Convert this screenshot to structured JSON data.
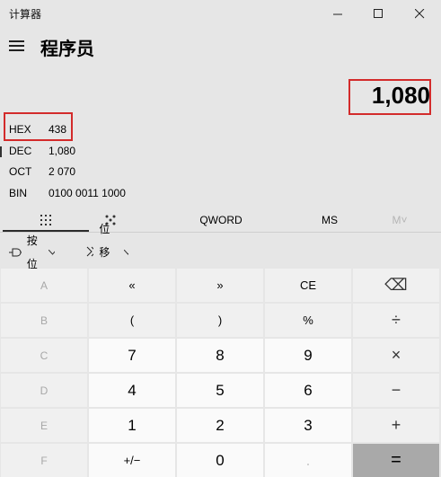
{
  "window": {
    "title": "计算器",
    "controls": [
      "minimize",
      "maximize",
      "close"
    ]
  },
  "header": {
    "mode_title": "程序员"
  },
  "display": {
    "value": "1,080"
  },
  "radix": [
    {
      "label": "HEX",
      "value": "438"
    },
    {
      "label": "DEC",
      "value": "1,080"
    },
    {
      "label": "OCT",
      "value": "2 070"
    },
    {
      "label": "BIN",
      "value": "0100 0011 1000"
    }
  ],
  "keyboard_tabs": {
    "word_size": "QWORD",
    "memory_store": "MS",
    "memory_list": "M˅"
  },
  "ops_bar": {
    "bitwise": "按位",
    "bitshift": "位移位"
  },
  "keys": [
    [
      "A",
      "«",
      "»",
      "CE",
      "⌫"
    ],
    [
      "B",
      "(",
      ")",
      "%",
      "÷"
    ],
    [
      "C",
      "7",
      "8",
      "9",
      "×"
    ],
    [
      "D",
      "4",
      "5",
      "6",
      "−"
    ],
    [
      "E",
      "1",
      "2",
      "3",
      "+"
    ],
    [
      "F",
      "+/−",
      "0",
      ".",
      "="
    ]
  ],
  "colors": {
    "background": "#e6e6e6",
    "highlight_box": "#d32b2b",
    "equals_key": "#a9a9a9"
  }
}
